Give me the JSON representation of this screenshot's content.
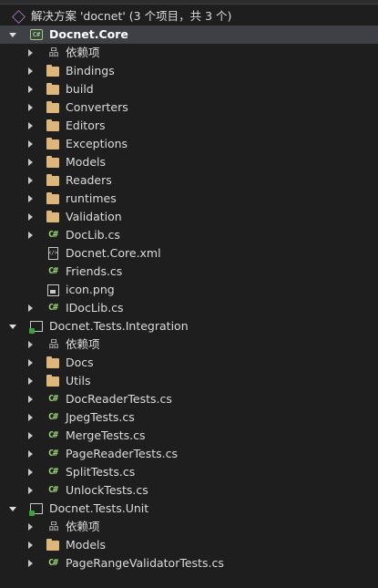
{
  "solution": {
    "label": "解决方案 'docnet' (3 个项目，共 3 个)"
  },
  "projects": [
    {
      "name": "Docnet.Core",
      "items": [
        "依赖项",
        "Bindings",
        "build",
        "Converters",
        "Editors",
        "Exceptions",
        "Models",
        "Readers",
        "runtimes",
        "Validation",
        "DocLib.cs",
        "Docnet.Core.xml",
        "Friends.cs",
        "icon.png",
        "IDocLib.cs"
      ]
    },
    {
      "name": "Docnet.Tests.Integration",
      "items": [
        "依赖项",
        "Docs",
        "Utils",
        "DocReaderTests.cs",
        "JpegTests.cs",
        "MergeTests.cs",
        "PageReaderTests.cs",
        "SplitTests.cs",
        "UnlockTests.cs"
      ]
    },
    {
      "name": "Docnet.Tests.Unit",
      "items": [
        "依赖项",
        "Models",
        "PageRangeValidatorTests.cs"
      ]
    }
  ],
  "icons": {
    "csharp_glyph": "C#",
    "core_project_glyph": "C#",
    "xml_glyph": "</>",
    "dependencies_glyph": "品"
  },
  "colors": {
    "background": "#1e1e1e",
    "text": "#dcdcdc",
    "folder": "#dcb67a",
    "csharp": "#9ad17a",
    "selection": "#3f3f46"
  }
}
